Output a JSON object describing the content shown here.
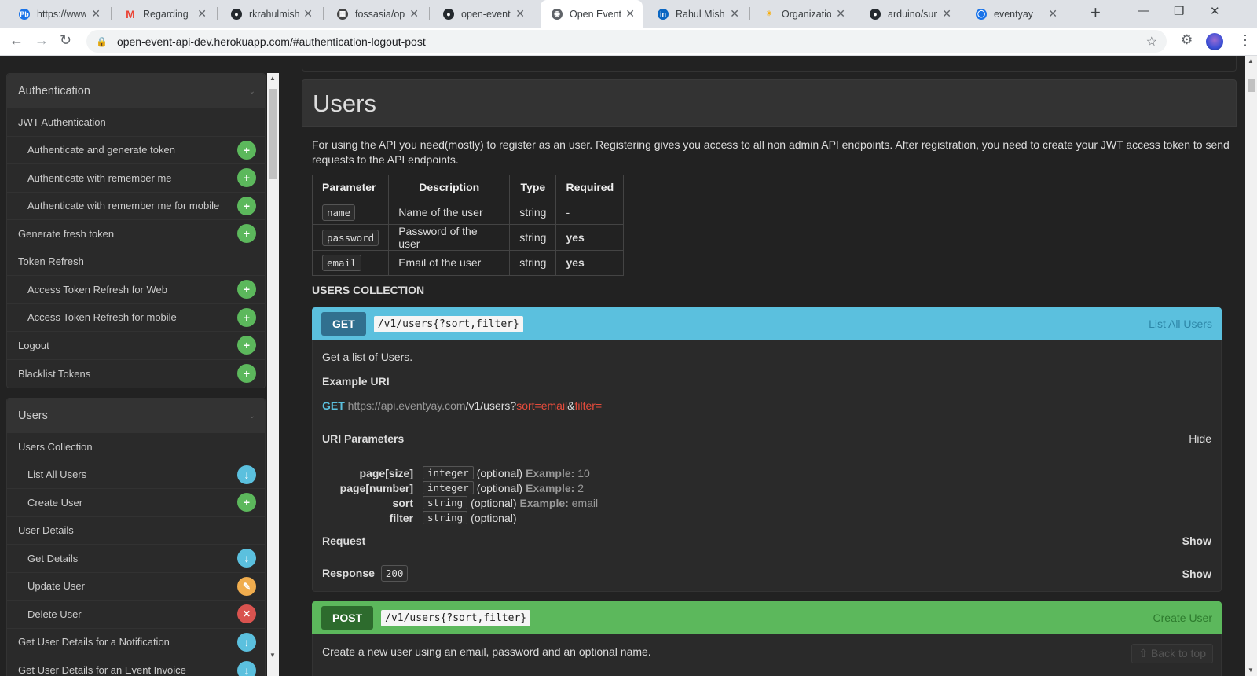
{
  "browser": {
    "tabs": [
      {
        "title": "https://www.p",
        "favicon": "pb-icon",
        "color": "#1a73e8"
      },
      {
        "title": "Regarding Pro",
        "favicon": "gmail-icon",
        "color": "#ea4335"
      },
      {
        "title": "rkrahulmishra",
        "favicon": "github-icon",
        "color": "#24292e"
      },
      {
        "title": "fossasia/open",
        "favicon": "fossasia-icon",
        "color": "#444"
      },
      {
        "title": "open-event-s",
        "favicon": "github-icon",
        "color": "#24292e"
      },
      {
        "title": "Open Event A",
        "favicon": "globe-icon",
        "color": "#5f6368",
        "active": true
      },
      {
        "title": "Rahul Mishra",
        "favicon": "linkedin-icon",
        "color": "#0a66c2"
      },
      {
        "title": "Organizations",
        "favicon": "sun-icon",
        "color": "#f9ab00"
      },
      {
        "title": "arduino/sumn",
        "favicon": "github-icon",
        "color": "#24292e"
      },
      {
        "title": "eventyay",
        "favicon": "eventyay-icon",
        "color": "#1a73e8"
      }
    ],
    "url": "open-event-api-dev.herokuapp.com/#authentication-logout-post"
  },
  "sidebar": {
    "groups": [
      {
        "title": "Authentication",
        "items": [
          {
            "label": "JWT Authentication",
            "level": 1,
            "icon": ""
          },
          {
            "label": "Authenticate and generate token",
            "level": 2,
            "icon": "plus"
          },
          {
            "label": "Authenticate with remember me",
            "level": 2,
            "icon": "plus"
          },
          {
            "label": "Authenticate with remember me for mobile",
            "level": 2,
            "icon": "plus"
          },
          {
            "label": "Generate fresh token",
            "level": 1,
            "icon": "plus"
          },
          {
            "label": "Token Refresh",
            "level": 1,
            "icon": ""
          },
          {
            "label": "Access Token Refresh for Web",
            "level": 2,
            "icon": "plus"
          },
          {
            "label": "Access Token Refresh for mobile",
            "level": 2,
            "icon": "plus"
          },
          {
            "label": "Logout",
            "level": 1,
            "icon": "plus"
          },
          {
            "label": "Blacklist Tokens",
            "level": 1,
            "icon": "plus"
          }
        ]
      },
      {
        "title": "Users",
        "items": [
          {
            "label": "Users Collection",
            "level": 1,
            "icon": ""
          },
          {
            "label": "List All Users",
            "level": 2,
            "icon": "down"
          },
          {
            "label": "Create User",
            "level": 2,
            "icon": "plus"
          },
          {
            "label": "User Details",
            "level": 1,
            "icon": ""
          },
          {
            "label": "Get Details",
            "level": 2,
            "icon": "down"
          },
          {
            "label": "Update User",
            "level": 2,
            "icon": "edit"
          },
          {
            "label": "Delete User",
            "level": 2,
            "icon": "del"
          },
          {
            "label": "Get User Details for a Notification",
            "level": 1,
            "icon": "down"
          },
          {
            "label": "Get User Details for an Event Invoice",
            "level": 1,
            "icon": "down"
          }
        ]
      }
    ]
  },
  "main": {
    "heading": "Users",
    "intro": "For using the API you need(mostly) to register as an user. Registering gives you access to all non admin API endpoints. After registration, you need to create your JWT access token to send requests to the API endpoints.",
    "param_table": {
      "headers": [
        "Parameter",
        "Description",
        "Type",
        "Required"
      ],
      "rows": [
        {
          "param": "name",
          "desc": "Name of the user",
          "type": "string",
          "required": "-"
        },
        {
          "param": "password",
          "desc": "Password of the user",
          "type": "string",
          "required": "yes"
        },
        {
          "param": "email",
          "desc": "Email of the user",
          "type": "string",
          "required": "yes"
        }
      ]
    },
    "collection_heading": "USERS COLLECTION",
    "get_action": {
      "method": "GET",
      "path": "/v1/users{?sort,filter}",
      "title": "List All Users",
      "description": "Get a list of Users.",
      "example_uri_label": "Example URI",
      "uri_method": "GET",
      "uri_host": "https://api.eventyay.com",
      "uri_path": "/v1/users?",
      "uri_q1": "sort=email",
      "uri_amp": "&",
      "uri_q2": "filter=",
      "uri_params_label": "URI Parameters",
      "hide_label": "Hide",
      "params": [
        {
          "name": "page[size]",
          "type": "integer",
          "optional": "(optional)",
          "example_label": "Example:",
          "example": "10"
        },
        {
          "name": "page[number]",
          "type": "integer",
          "optional": "(optional)",
          "example_label": "Example:",
          "example": "2"
        },
        {
          "name": "sort",
          "type": "string",
          "optional": "(optional)",
          "example_label": "Example:",
          "example": "email"
        },
        {
          "name": "filter",
          "type": "string",
          "optional": "(optional)",
          "example_label": "",
          "example": ""
        }
      ],
      "request_label": "Request",
      "request_toggle": "Show",
      "response_label": "Response",
      "response_code": "200",
      "response_toggle": "Show"
    },
    "post_action": {
      "method": "POST",
      "path": "/v1/users{?sort,filter}",
      "title": "Create User",
      "description": "Create a new user using an email, password and an optional name.",
      "back_to_top": "Back to top"
    }
  },
  "colors": {
    "page_bg": "#222222",
    "get_bar": "#5bc0de",
    "post_bar": "#5cb85c",
    "plus_icon": "#5cb85c",
    "down_icon": "#5bc0de",
    "edit_icon": "#f0ad4e",
    "delete_icon": "#d9534f"
  }
}
